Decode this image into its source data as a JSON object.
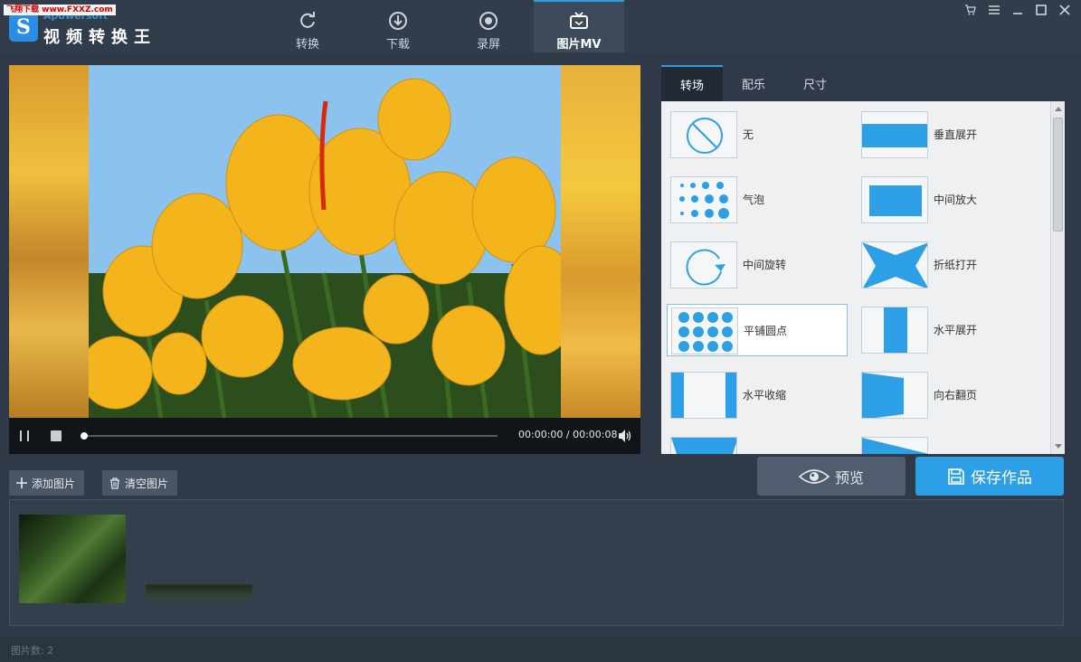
{
  "watermark": "飞翔下载 www.FXXZ.com",
  "brand": {
    "small": "Apowersoft",
    "title": "视频转换王"
  },
  "nav": {
    "tabs": [
      {
        "label": "转换",
        "icon": "refresh-icon"
      },
      {
        "label": "下载",
        "icon": "download-icon"
      },
      {
        "label": "录屏",
        "icon": "record-icon"
      },
      {
        "label": "图片MV",
        "icon": "tv-icon",
        "active": true
      }
    ]
  },
  "window_controls": [
    "cart-icon",
    "menu-icon",
    "minimize-icon",
    "maximize-icon",
    "close-icon"
  ],
  "player": {
    "time": "00:00:00 / 00:00:08",
    "progress": 0
  },
  "effects": {
    "tabs": [
      "转场",
      "配乐",
      "尺寸"
    ],
    "active_tab": "转场",
    "items": [
      {
        "label": "无",
        "icon": "none-icon"
      },
      {
        "label": "垂直展开",
        "icon": "vertical-expand-icon"
      },
      {
        "label": "气泡",
        "icon": "bubble-icon"
      },
      {
        "label": "中间放大",
        "icon": "center-zoom-icon"
      },
      {
        "label": "中间旋转",
        "icon": "center-rotate-icon"
      },
      {
        "label": "折纸打开",
        "icon": "fold-open-icon"
      },
      {
        "label": "平铺圆点",
        "icon": "tile-dots-icon",
        "selected": true
      },
      {
        "label": "水平展开",
        "icon": "horizontal-expand-icon"
      },
      {
        "label": "水平收缩",
        "icon": "horizontal-shrink-icon"
      },
      {
        "label": "向右翻页",
        "icon": "page-flip-right-icon"
      }
    ]
  },
  "toolbar": {
    "add_label": "添加图片",
    "clear_label": "清空图片",
    "preview_label": "预览",
    "save_label": "保存作品"
  },
  "status": {
    "count_text": "图片数: 2"
  },
  "colors": {
    "accent": "#2c9fe6",
    "background": "#2f3947",
    "panel": "#eef0f2"
  }
}
